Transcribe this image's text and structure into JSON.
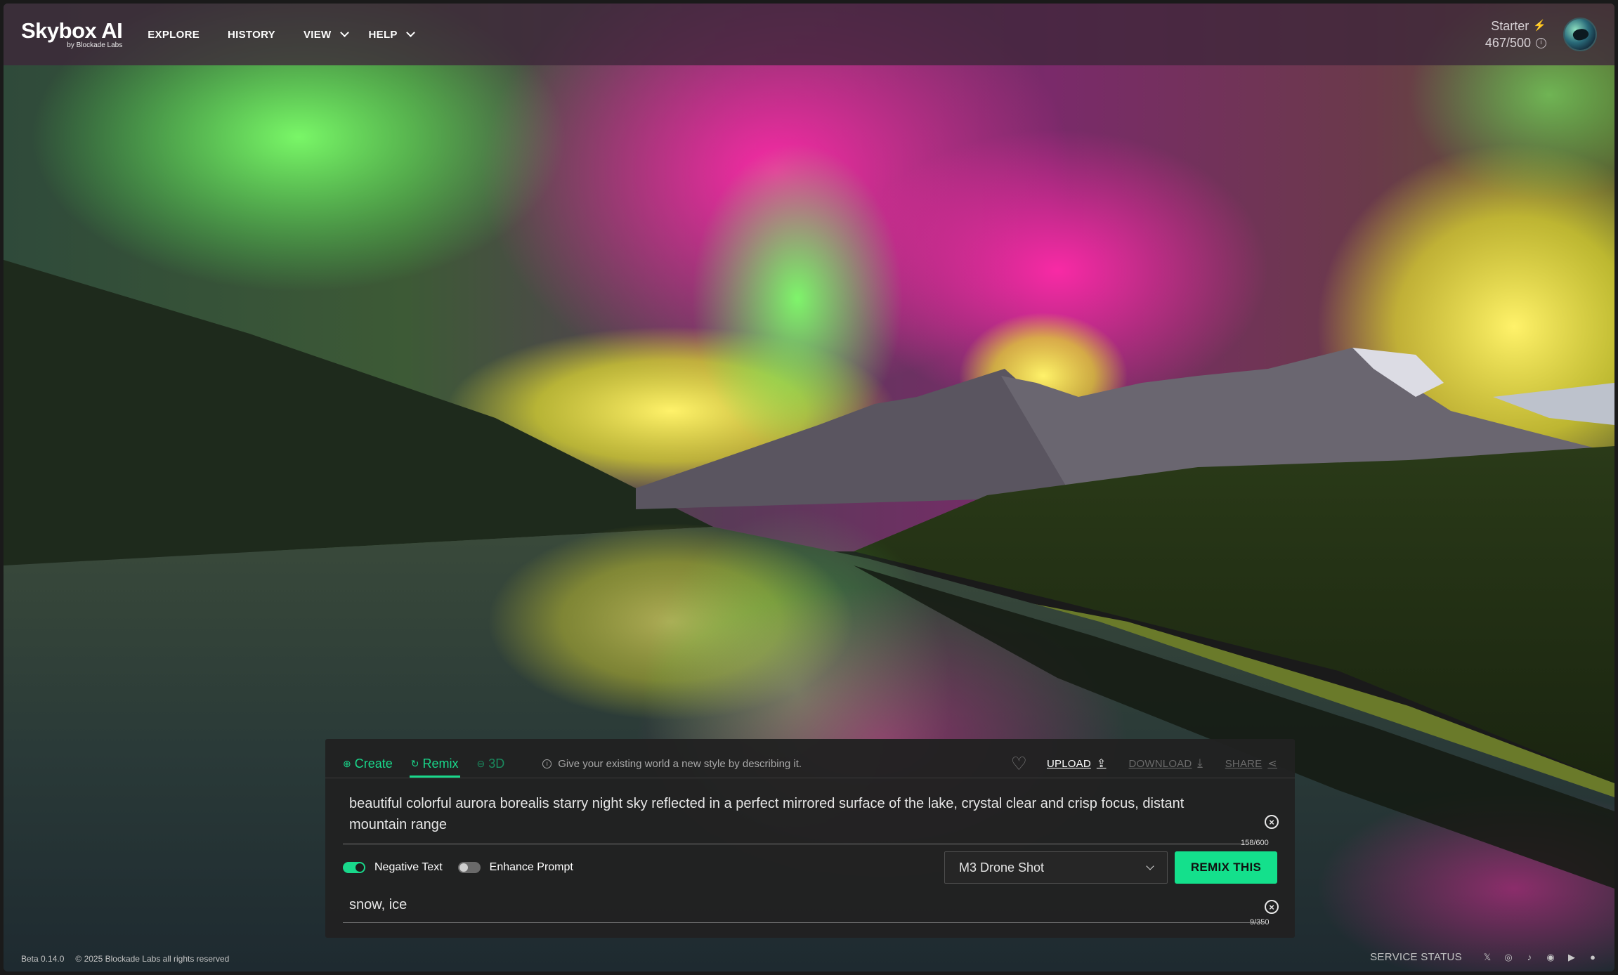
{
  "header": {
    "logo_main": "Skybox AI",
    "logo_sub": "by Blockade Labs",
    "nav": [
      {
        "label": "EXPLORE"
      },
      {
        "label": "HISTORY"
      },
      {
        "label": "VIEW"
      },
      {
        "label": "HELP"
      }
    ],
    "plan_name": "Starter",
    "credits": "467/500",
    "bolt_icon": "⚡",
    "info_icon": "i"
  },
  "panel": {
    "tabs": [
      {
        "label": "Create",
        "icon": "⊕"
      },
      {
        "label": "Remix",
        "icon": "↻"
      },
      {
        "label": "3D",
        "icon": "⊖"
      }
    ],
    "hint": "Give your existing world a new style by describing it.",
    "hint_icon": "i",
    "heart_icon": "♡",
    "actions": {
      "upload": "UPLOAD",
      "download": "DOWNLOAD",
      "share": "SHARE"
    },
    "prompt": "beautiful colorful aurora borealis starry night sky reflected in a perfect mirrored surface of the lake, crystal clear and crisp focus, distant mountain range",
    "prompt_counter": "158/600",
    "negative_toggle": "Negative Text",
    "enhance_toggle": "Enhance Prompt",
    "style_select": "M3 Drone Shot",
    "remix_button": "REMIX THIS",
    "negative_text": "snow, ice",
    "negative_counter": "9/350",
    "clear_icon": "×"
  },
  "footer": {
    "version": "Beta 0.14.0",
    "copyright": "© 2025 Blockade Labs all rights reserved",
    "service_status": "SERVICE STATUS",
    "social_icons": [
      "𝕏",
      "◎",
      "♪",
      "◉",
      "▶",
      "●"
    ]
  },
  "colors": {
    "accent": "#19d88b",
    "button": "#14e08c",
    "topbar": "#3e263a",
    "panel": "#212121"
  }
}
